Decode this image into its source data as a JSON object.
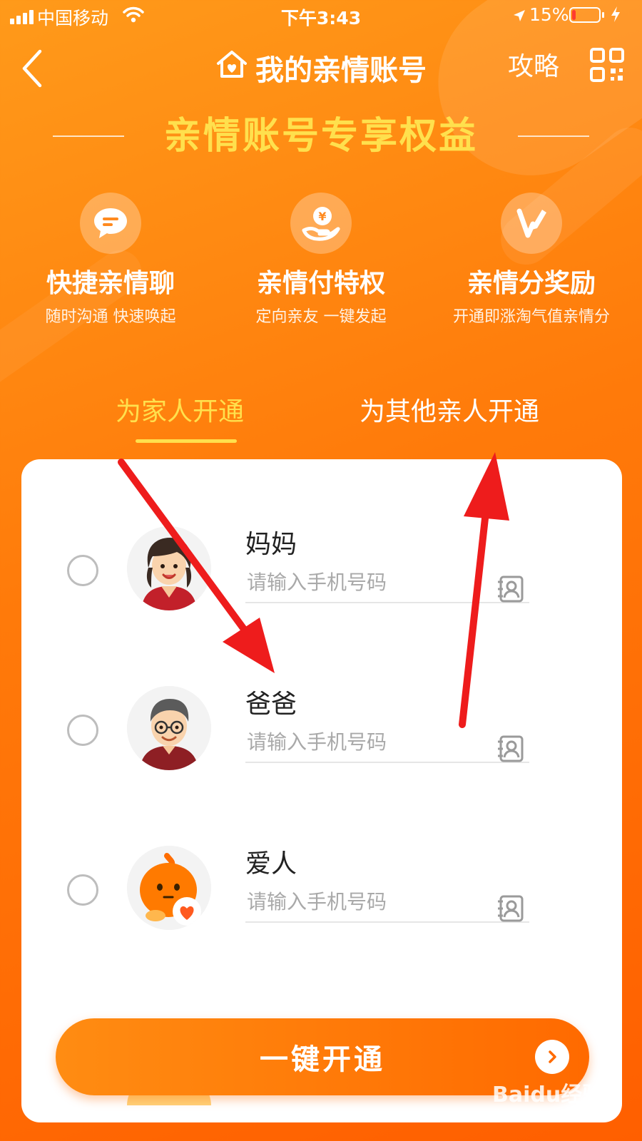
{
  "status_bar": {
    "carrier": "中国移动",
    "time": "下午3:43",
    "battery_percent": "15%",
    "battery_level": 0.15,
    "battery_color": "#ff3b30"
  },
  "nav": {
    "back_icon": "chevron-left-icon",
    "title": "我的亲情账号",
    "title_icon": "home-heart-icon",
    "guide_label": "攻略",
    "qr_icon": "qr-code-icon"
  },
  "banner": {
    "title": "亲情账号专享权益"
  },
  "features": [
    {
      "icon": "chat-bubble-icon",
      "title": "快捷亲情聊",
      "desc": "随时沟通 快速唤起"
    },
    {
      "icon": "hand-yuan-icon",
      "title": "亲情付特权",
      "desc": "定向亲友 一键发起"
    },
    {
      "icon": "v-pencil-icon",
      "title": "亲情分奖励",
      "desc": "开通即涨淘气值亲情分"
    }
  ],
  "tabs": [
    {
      "label": "为家人开通",
      "active": true
    },
    {
      "label": "为其他亲人开通",
      "active": false
    }
  ],
  "members": [
    {
      "name": "妈妈",
      "placeholder": "请输入手机号码",
      "value": "",
      "avatar": "mother-avatar"
    },
    {
      "name": "爸爸",
      "placeholder": "请输入手机号码",
      "value": "",
      "avatar": "father-avatar"
    },
    {
      "name": "爱人",
      "placeholder": "请输入手机号码",
      "value": "",
      "avatar": "spouse-mascot-avatar"
    }
  ],
  "cta": {
    "label": "一键开通",
    "icon": "chevron-right-circle-icon"
  },
  "watermark": {
    "brand": "Baidu经验",
    "url": "jingyan.baidu.com"
  },
  "colors": {
    "accent_yellow": "#ffe04d",
    "orange_primary": "#ff7a0a",
    "annotation_red": "#ee1c1c"
  }
}
